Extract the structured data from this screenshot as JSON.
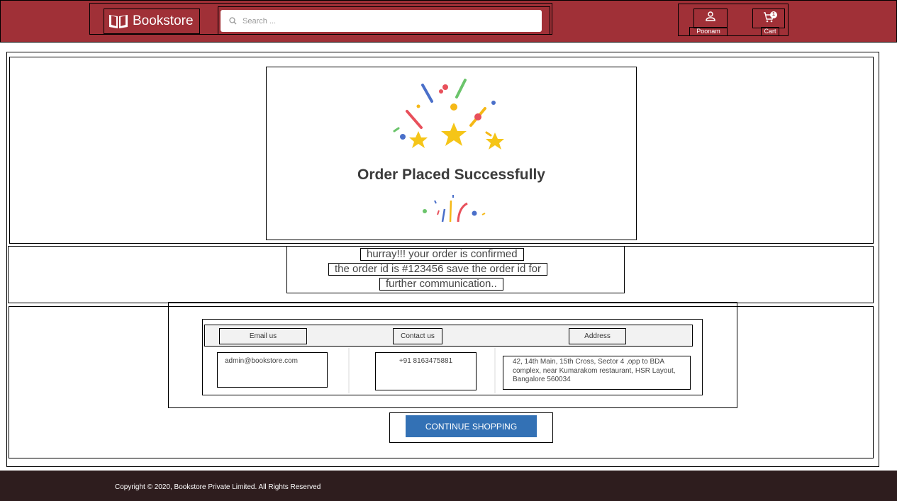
{
  "header": {
    "logo_text": "Bookstore",
    "search_placeholder": "Search ...",
    "profile_label": "Poonam",
    "cart_label": "Cart",
    "cart_count": "1",
    "brand_color": "#a03037"
  },
  "confirmation": {
    "title": "Order Placed Successfully",
    "message_line1": "hurray!!! your order is confirmed",
    "message_line2": "the order id is #123456 save the order id for",
    "message_line3": "further communication.."
  },
  "contact_table": {
    "headers": [
      "Email us",
      "Contact us",
      "Address"
    ],
    "email": "admin@bookstore.com",
    "phone": "+91 8163475881",
    "address_line1": "42, 14th Main, 15th Cross, Sector 4 ,opp to BDA",
    "address_line2": "complex, near Kumarakom restaurant, HSR Layout,",
    "address_line3": "Bangalore 560034"
  },
  "actions": {
    "continue_label": "CONTINUE SHOPPING",
    "button_color": "#3371b5"
  },
  "footer": {
    "copyright": "Copyright © 2020, Bookstore Private Limited. All Rights Reserved"
  }
}
